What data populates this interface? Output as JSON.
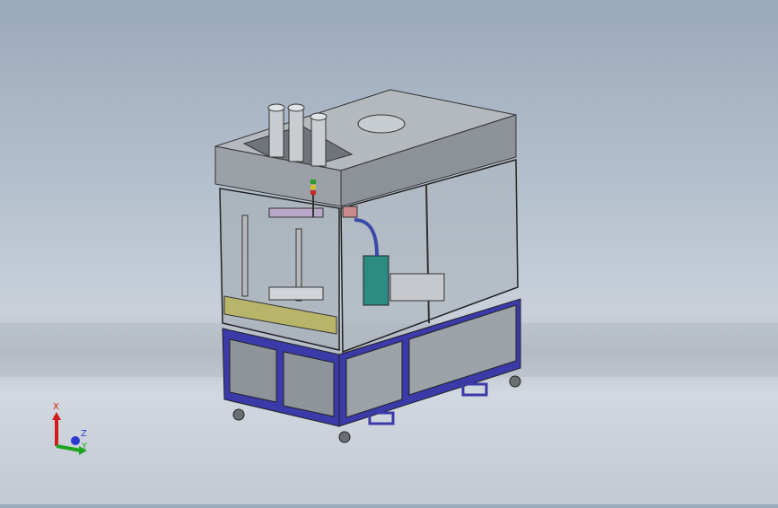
{
  "viewport": {
    "model": "machine-assembly",
    "background_gradient": [
      "#9aa9bb",
      "#c9d0da",
      "#d2d8e0"
    ]
  },
  "triad": {
    "x_label": "X",
    "y_label": "Y",
    "z_label": "Z",
    "x_color": "#d21b1b",
    "y_color": "#1ea51e",
    "z_color": "#2a3ccf"
  },
  "colors": {
    "frame_base": "#3a3aa8",
    "panel_gray": "#8e949a",
    "housing_gray": "#9ba2a8",
    "glass": "#a9b3bb",
    "yellow_strip": "#b8b56a"
  }
}
